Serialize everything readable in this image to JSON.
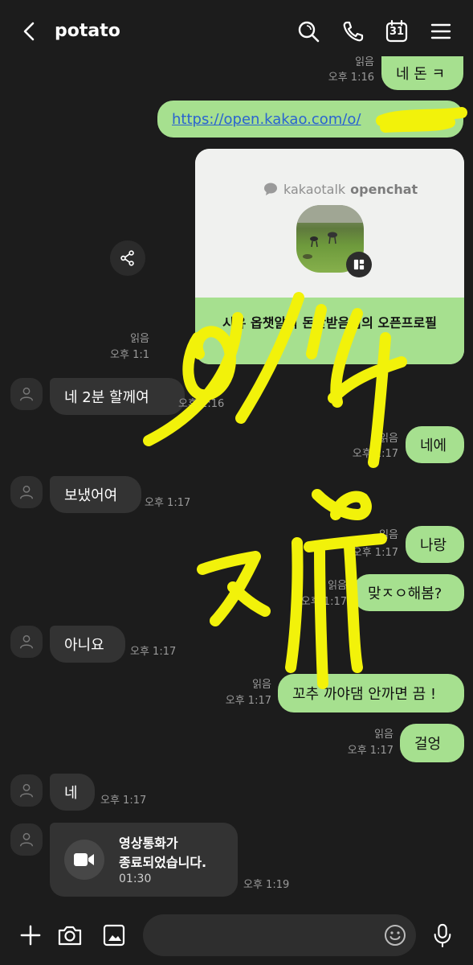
{
  "header": {
    "title": "potato",
    "calendar_label": "31"
  },
  "messages": {
    "m0": {
      "text": "네 돈 ㅋ",
      "read": "읽음",
      "time": "오후 1:16"
    },
    "link": {
      "text": "https://open.kakao.com/o/"
    },
    "card": {
      "brand_prefix": "kakaotalk",
      "brand_suffix": "openchat",
      "title": "시유 옵챗알릭 돈만받음님의 오픈프로필",
      "read": "읽음",
      "time": "오후 1:1"
    },
    "m1": {
      "text": "네 2분 할께여",
      "time": "오후 1:16"
    },
    "m2": {
      "text": "네에",
      "read": "읽음",
      "time": "오후 1:17"
    },
    "m3": {
      "text": "보냈어여",
      "time": "오후 1:17"
    },
    "m4": {
      "text": "나랑",
      "read": "읽음",
      "time": "오후 1:17"
    },
    "m5": {
      "text": "맞ㅈㅇ해봄?",
      "read": "읽음",
      "time": "오후 1:17"
    },
    "m6": {
      "text": "아니요",
      "time": "오후 1:17"
    },
    "m7": {
      "text": "꼬추 까야댐 안까면 끔 !",
      "read": "읽음",
      "time": "오후 1:17"
    },
    "m8": {
      "text": "걸엉",
      "read": "읽음",
      "time": "오후 1:17"
    },
    "m9": {
      "text": "네",
      "time": "오후 1:17"
    },
    "call": {
      "line1": "영상통화가",
      "line2": "종료되었습니다.",
      "duration": "01:30",
      "time": "오후 1:19"
    }
  },
  "icons": {
    "back": "back-arrow-icon",
    "search": "search-icon",
    "phone": "phone-icon",
    "calendar": "calendar-icon",
    "menu": "menu-icon",
    "share": "share-icon",
    "avatar": "person-icon",
    "video": "video-camera-icon",
    "plus": "plus-icon",
    "camera": "camera-icon",
    "gallery": "gallery-icon",
    "emoji": "emoji-icon",
    "mic": "mic-icon"
  },
  "colors": {
    "background": "#1c1c1c",
    "my_bubble": "#a6e08f",
    "their_bubble": "#333333",
    "highlighter": "#f2f20a"
  }
}
